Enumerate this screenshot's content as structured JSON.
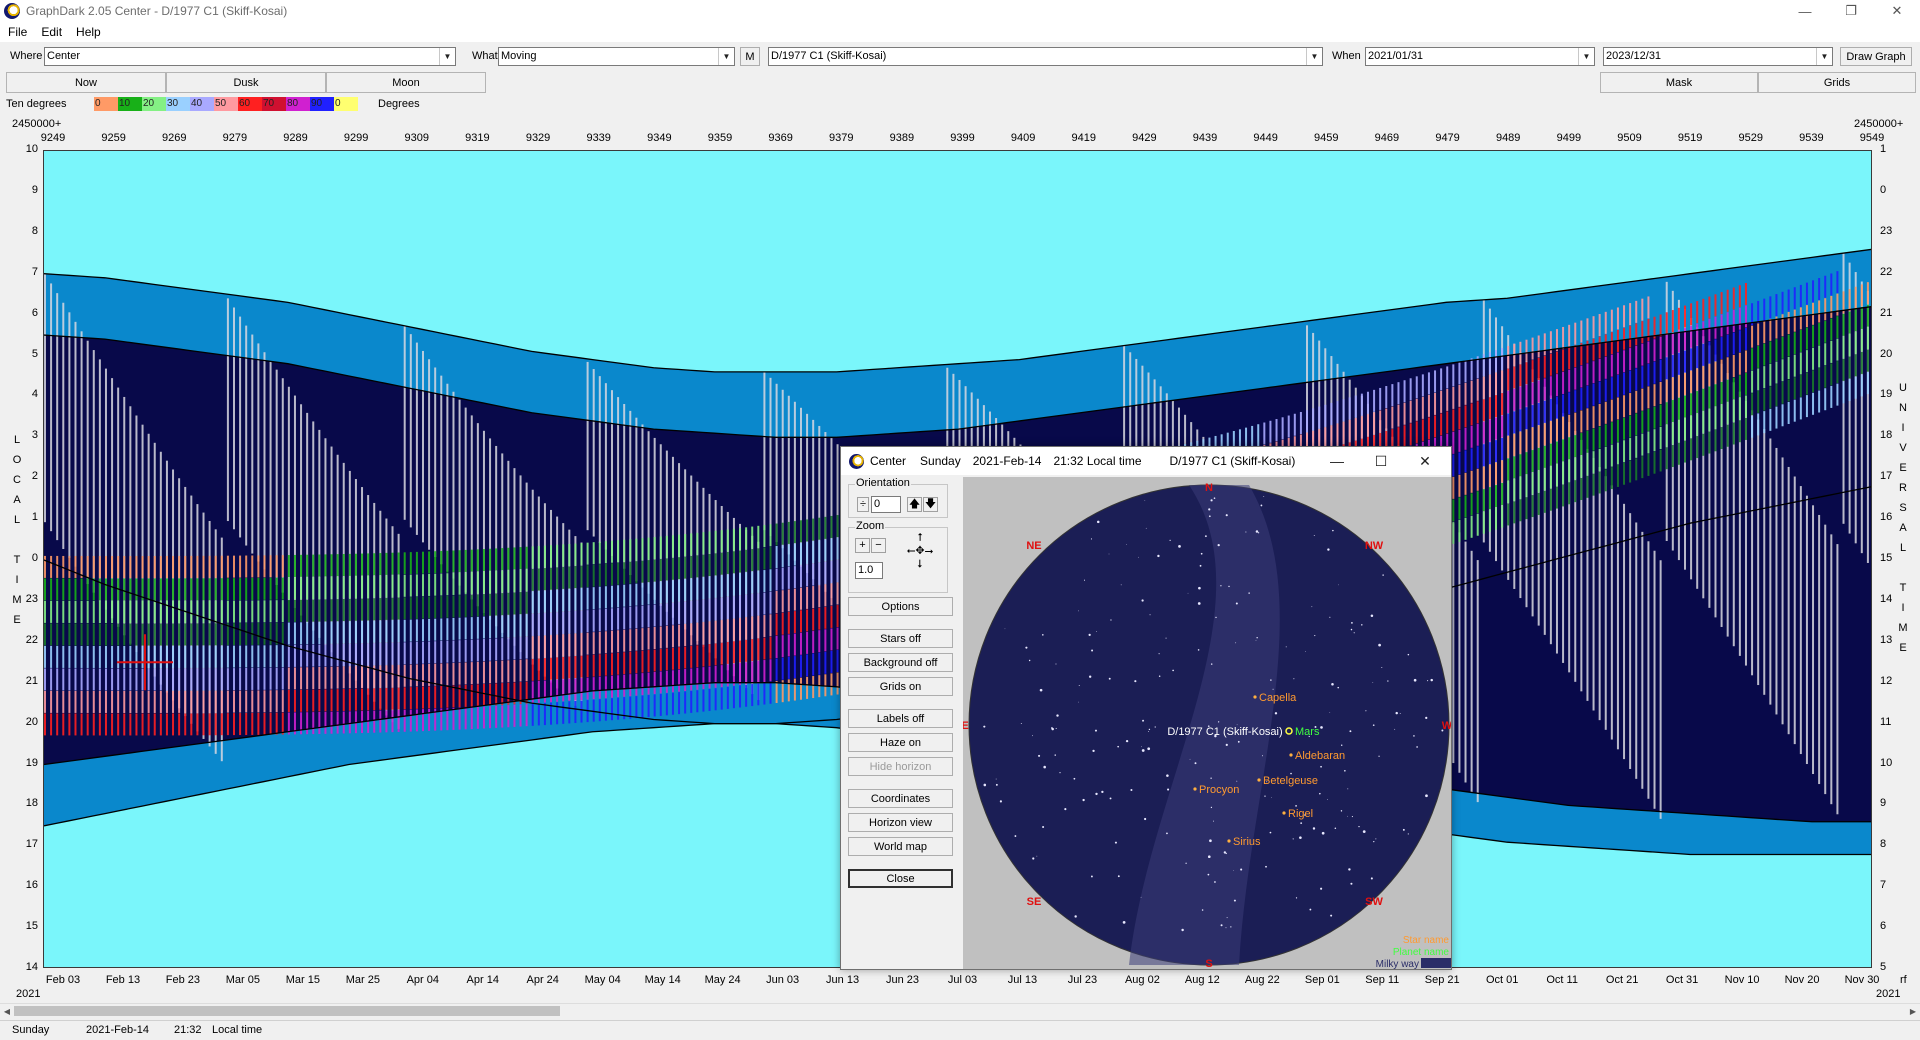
{
  "window": {
    "title": "GraphDark 2.05  Center  -  D/1977 C1 (Skiff-Kosai)",
    "min": "—",
    "max": "❐",
    "close": "✕"
  },
  "menu": [
    "File",
    "Edit",
    "Help"
  ],
  "toolbar": {
    "where_label": "Where",
    "where_value": "Center",
    "what_label": "What",
    "what_value": "Moving",
    "m_label": "M",
    "object_value": "D/1977 C1 (Skiff-Kosai)",
    "when_label": "When",
    "when_from": "2021/01/31",
    "when_to": "2023/12/31",
    "draw_graph": "Draw Graph",
    "now": "Now",
    "dusk": "Dusk",
    "moon": "Moon",
    "mask": "Mask",
    "grids": "Grids"
  },
  "legend": {
    "left_label": "Ten degrees",
    "right_label": "Degrees",
    "swatches": [
      {
        "label": "0",
        "color": "#ff9a66"
      },
      {
        "label": "10",
        "color": "#18b018"
      },
      {
        "label": "20",
        "color": "#84f084"
      },
      {
        "label": "30",
        "color": "#9ad0ff"
      },
      {
        "label": "40",
        "color": "#a9a9ff"
      },
      {
        "label": "50",
        "color": "#ff9aa0"
      },
      {
        "label": "60",
        "color": "#ff2020"
      },
      {
        "label": "70",
        "color": "#d01030"
      },
      {
        "label": "80",
        "color": "#d020d0"
      },
      {
        "label": "90",
        "color": "#2020ff"
      },
      {
        "label": "0",
        "color": "#ffff70"
      }
    ]
  },
  "chart_data": {
    "type": "area",
    "jd_offset_label_left": "2450000+",
    "jd_offset_label_right": "2450000+",
    "top_ticks": [
      "9249",
      "9259",
      "9269",
      "9279",
      "9289",
      "9299",
      "9309",
      "9319",
      "9329",
      "9339",
      "9349",
      "9359",
      "9369",
      "9379",
      "9389",
      "9399",
      "9409",
      "9419",
      "9429",
      "9439",
      "9449",
      "9459",
      "9469",
      "9479",
      "9489",
      "9499",
      "9509",
      "9519",
      "9529",
      "9539",
      "9549"
    ],
    "bottom_ticks": [
      "Feb 03",
      "Feb 13",
      "Feb 23",
      "Mar 05",
      "Mar 15",
      "Mar 25",
      "Apr 04",
      "Apr 14",
      "Apr 24",
      "May 04",
      "May 14",
      "May 24",
      "Jun 03",
      "Jun 13",
      "Jun 23",
      "Jul 03",
      "Jul 13",
      "Jul 23",
      "Aug 02",
      "Aug 12",
      "Aug 22",
      "Sep 01",
      "Sep 11",
      "Sep 21",
      "Oct 01",
      "Oct 11",
      "Oct 21",
      "Oct 31",
      "Nov 10",
      "Nov 20",
      "Nov 30"
    ],
    "year_left": "2021",
    "year_right": "2021",
    "trailing_label": "rf",
    "left_ticks": [
      "10",
      "9",
      "8",
      "7",
      "6",
      "5",
      "4",
      "3",
      "2",
      "1",
      "0",
      "23",
      "22",
      "21",
      "20",
      "19",
      "18",
      "17",
      "16",
      "15",
      "14"
    ],
    "right_ticks": [
      "1",
      "0",
      "23",
      "22",
      "21",
      "20",
      "19",
      "18",
      "17",
      "16",
      "15",
      "14",
      "13",
      "12",
      "11",
      "10",
      "9",
      "8",
      "7",
      "6",
      "5"
    ],
    "left_axis_label": "LOCAL TIME",
    "right_axis_label": "UNIVERSAL TIME",
    "ylim": [
      14,
      34
    ],
    "x": [
      0,
      10,
      20,
      30,
      40,
      50,
      60,
      70,
      80,
      90,
      100,
      110,
      120,
      130,
      140,
      150,
      160,
      170,
      180,
      190,
      200,
      210,
      220,
      230,
      240,
      250,
      260,
      270,
      280,
      290,
      300
    ],
    "series": [
      {
        "values": [
          31.0,
          30.9,
          30.7,
          30.5,
          30.3,
          30.0,
          29.7,
          29.4,
          29.1,
          28.9,
          28.7,
          28.6,
          28.6,
          28.6,
          28.7,
          28.8,
          28.9,
          29.1,
          29.3,
          29.5,
          29.7,
          29.9,
          30.1,
          30.3,
          30.4,
          30.6,
          30.8,
          31.0,
          31.2,
          31.4,
          31.6
        ]
      },
      {
        "values": [
          29.5,
          29.4,
          29.2,
          29.0,
          28.8,
          28.5,
          28.2,
          27.9,
          27.6,
          27.4,
          27.2,
          27.1,
          27.0,
          27.0,
          27.1,
          27.2,
          27.4,
          27.6,
          27.8,
          28.0,
          28.2,
          28.4,
          28.6,
          28.8,
          29.0,
          29.2,
          29.4,
          29.6,
          29.8,
          30.0,
          30.2
        ]
      },
      {
        "values": [
          24.0,
          23.4,
          22.9,
          22.4,
          21.9,
          21.5,
          21.1,
          20.8,
          20.5,
          20.3,
          20.1,
          20.0,
          20.0,
          20.1,
          20.3,
          20.5,
          20.8,
          21.1,
          21.4,
          21.7,
          22.1,
          22.5,
          22.9,
          23.3,
          23.7,
          24.1,
          24.5,
          24.9,
          25.2,
          25.5,
          25.8
        ]
      },
      {
        "values": [
          19.0,
          19.2,
          19.4,
          19.6,
          19.8,
          20.0,
          20.2,
          20.4,
          20.6,
          20.8,
          20.9,
          21.0,
          21.0,
          20.9,
          20.7,
          20.5,
          20.2,
          19.9,
          19.6,
          19.3,
          19.0,
          18.8,
          18.6,
          18.4,
          18.2,
          18.0,
          17.9,
          17.8,
          17.7,
          17.6,
          17.6
        ]
      },
      {
        "values": [
          17.5,
          17.8,
          18.1,
          18.4,
          18.7,
          19.0,
          19.2,
          19.4,
          19.6,
          19.8,
          19.9,
          20.0,
          20.0,
          19.9,
          19.7,
          19.4,
          19.1,
          18.8,
          18.5,
          18.2,
          17.9,
          17.7,
          17.5,
          17.3,
          17.1,
          17.0,
          16.9,
          16.8,
          16.8,
          16.8,
          16.8
        ]
      }
    ]
  },
  "status": {
    "day": "Sunday",
    "date": "2021-Feb-14",
    "time": "21:32",
    "tz": "Local time"
  },
  "popup": {
    "title_app": "Center",
    "title_day": "Sunday",
    "title_date": "2021-Feb-14",
    "title_time": "21:32 Local time",
    "title_object": "D/1977 C1 (Skiff-Kosai)",
    "orientation_label": "Orientation",
    "orientation_value": "0",
    "zoom_label": "Zoom",
    "zoom_value": "1.0",
    "buttons": {
      "options": "Options",
      "stars_off": "Stars off",
      "background_off": "Background off",
      "grids_on": "Grids on",
      "labels_off": "Labels off",
      "haze_on": "Haze on",
      "hide_horizon": "Hide horizon",
      "coordinates": "Coordinates",
      "horizon_view": "Horizon view",
      "world_map": "World map",
      "close": "Close"
    },
    "sky": {
      "directions": {
        "n": "N",
        "ne": "NE",
        "nw": "NW",
        "e": "E",
        "w": "W",
        "se": "SE",
        "sw": "SW",
        "s": "S"
      },
      "stars": [
        "Capella",
        "Aldebaran",
        "Betelgeuse",
        "Procyon",
        "Rigel",
        "Sirius"
      ],
      "object_label": "D/1977 C1 (Skiff-Kosai)",
      "planet": "Mars",
      "legend_star": "Star name",
      "legend_planet": "Planet name",
      "legend_milky": "Milky way"
    }
  }
}
